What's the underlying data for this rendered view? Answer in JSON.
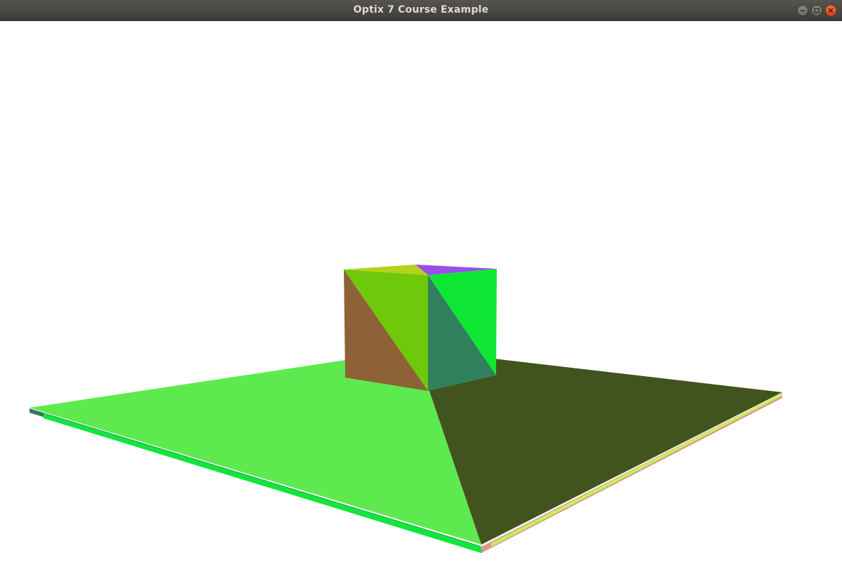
{
  "window": {
    "title": "Optix 7 Course Example"
  },
  "controls": {
    "minimize_icon": "minimize-icon",
    "maximize_icon": "maximize-icon",
    "close_icon": "close-icon"
  },
  "scene": {
    "background": "#ffffff",
    "floor_colors": {
      "top_left": "#5eea4e",
      "top_right": "#41541e",
      "edge_left": "#12e63c",
      "edge_left_dark": "#2e7a5a",
      "edge_right": "#d99a8e",
      "edge_right_light": "#c5f25a"
    },
    "cube_colors": {
      "front_lower": "#8d6236",
      "front_upper": "#6fc80a",
      "side_lower": "#327f5e",
      "side_upper": "#0fe633",
      "top_left": "#b5d21b",
      "top_right": "#9a4de8"
    }
  }
}
